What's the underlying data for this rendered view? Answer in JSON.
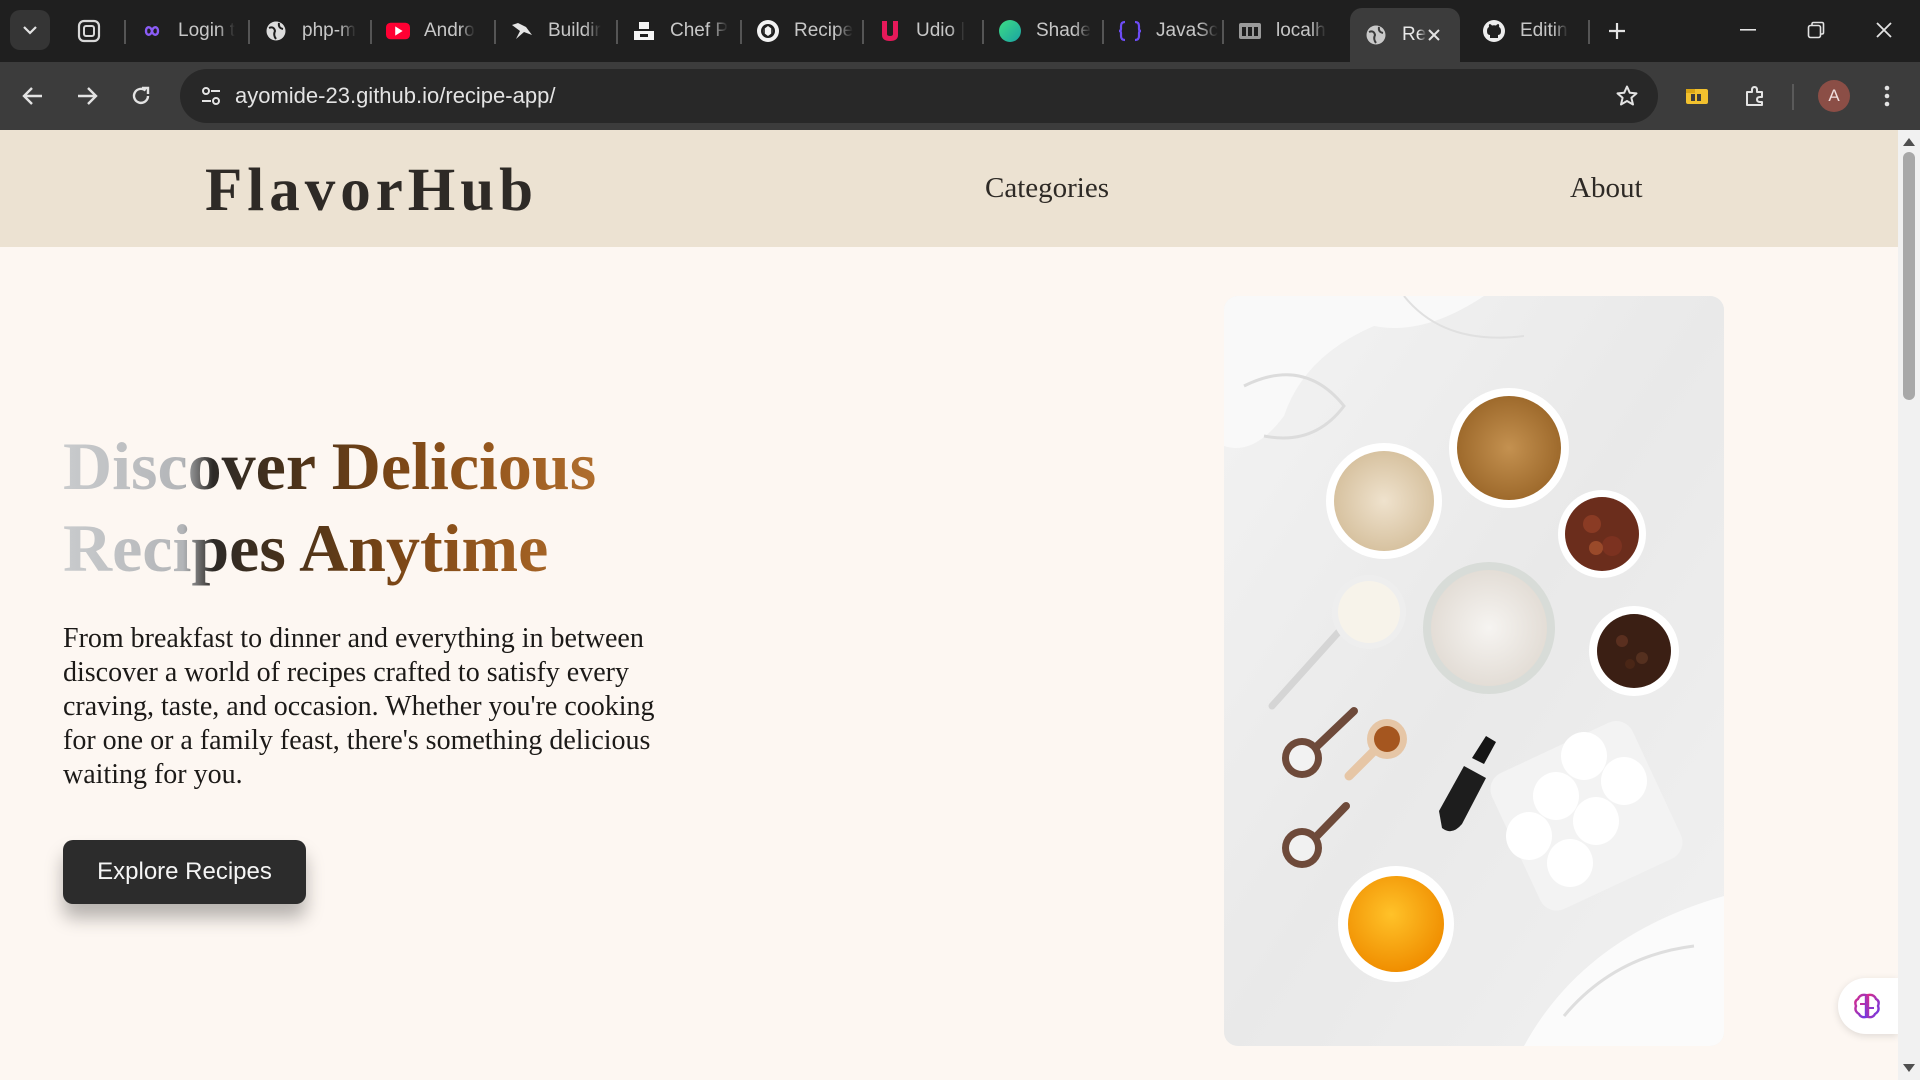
{
  "browser": {
    "tabs": [
      {
        "title": "Login t",
        "icon": "infinity-icon"
      },
      {
        "title": "php-m",
        "icon": "globe-icon"
      },
      {
        "title": "Andro",
        "icon": "youtube-icon"
      },
      {
        "title": "Buildir",
        "icon": "bird-icon"
      },
      {
        "title": "Chef P",
        "icon": "unsplash-icon"
      },
      {
        "title": "Recipe",
        "icon": "openai-icon"
      },
      {
        "title": "Udio |",
        "icon": "udio-icon"
      },
      {
        "title": "Shade",
        "icon": "circle-gradient-icon"
      },
      {
        "title": "JavaSc",
        "icon": "braces-icon"
      },
      {
        "title": "localh",
        "icon": "page-icon"
      },
      {
        "title": "Re",
        "icon": "globe-icon",
        "active": true
      },
      {
        "title": "Editin",
        "icon": "github-icon"
      }
    ],
    "url": {
      "host": "ayomide-23.github.io",
      "path": "/recipe-app/"
    },
    "profile_initial": "A"
  },
  "site": {
    "logo": "FlavorHub",
    "nav": {
      "categories": "Categories",
      "about": "About"
    },
    "hero": {
      "title_line1": "Discover Delicious",
      "title_line2": "Recipes Anytime",
      "description": "From breakfast to dinner and everything in between discover a world of recipes crafted to satisfy every craving, taste, and occasion. Whether you're cooking for one or a family feast, there's something delicious waiting for you.",
      "cta_label": "Explore Recipes"
    }
  },
  "colors": {
    "header_bg": "#ece2d2",
    "page_bg": "#fdf7f2",
    "accent_brown": "#8a5220",
    "cta_bg": "#2c2c2c"
  }
}
